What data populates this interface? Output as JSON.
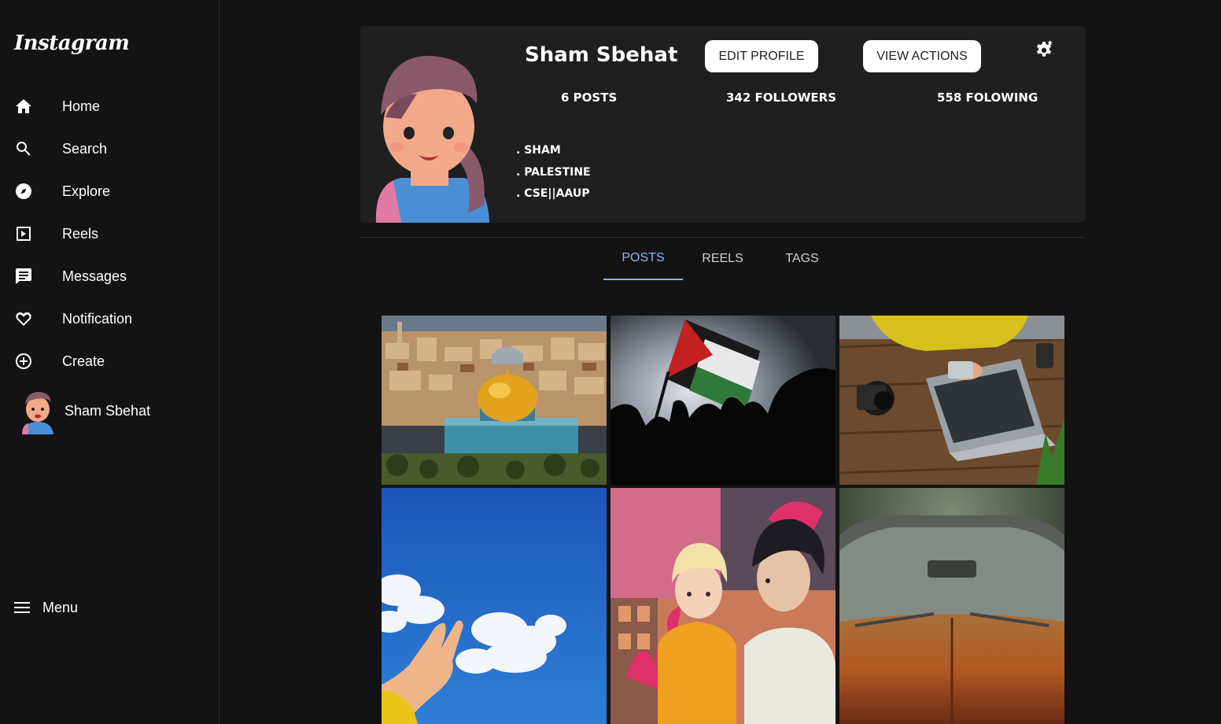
{
  "app": {
    "logo": "Instagram"
  },
  "sidebar": {
    "items": [
      {
        "label": "Home",
        "icon": "home-icon"
      },
      {
        "label": "Search",
        "icon": "search-icon"
      },
      {
        "label": "Explore",
        "icon": "compass-icon"
      },
      {
        "label": "Reels",
        "icon": "reels-icon"
      },
      {
        "label": "Messages",
        "icon": "message-icon"
      },
      {
        "label": "Notification",
        "icon": "heart-icon"
      },
      {
        "label": "Create",
        "icon": "plus-circle-icon"
      }
    ],
    "profile_label": "Sham Sbehat",
    "menu_label": "Menu"
  },
  "profile": {
    "username": "Sham Sbehat",
    "edit_label": "EDIT PROFILE",
    "actions_label": "VIEW ACTIONS",
    "posts": "6 POSTS",
    "followers": "342 FOLLOWERS",
    "following": "558 FOLOWING",
    "bio": [
      ". SHAM",
      ". PALESTINE",
      ". CSE||AAUP"
    ]
  },
  "tabs": [
    {
      "label": "POSTS",
      "active": true
    },
    {
      "label": "REELS",
      "active": false
    },
    {
      "label": "TAGS",
      "active": false
    }
  ],
  "posts": [
    {
      "subject": "dome-of-the-rock-city"
    },
    {
      "subject": "palestine-flag-silhouettes"
    },
    {
      "subject": "laptop-camera-desk"
    },
    {
      "subject": "hand-cloud-sky"
    },
    {
      "subject": "anime-couple-illustration"
    },
    {
      "subject": "vintage-car-hood"
    }
  ],
  "colors": {
    "accent": "#8ab4f8",
    "background": "#131313",
    "card": "#1f1f1f"
  }
}
